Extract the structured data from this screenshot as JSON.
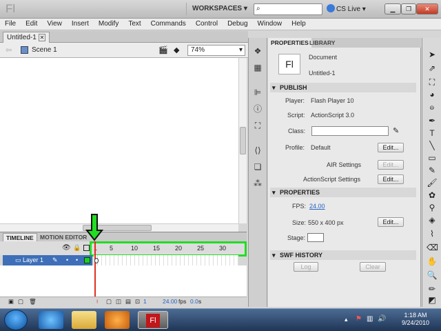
{
  "app": {
    "logo": "Fl",
    "workspaces": "WORKSPACES",
    "cs_live": "CS Live"
  },
  "menu": [
    "File",
    "Edit",
    "View",
    "Insert",
    "Modify",
    "Text",
    "Commands",
    "Control",
    "Debug",
    "Window",
    "Help"
  ],
  "document": {
    "tab": "Untitled-1",
    "scene": "Scene 1",
    "zoom": "74%"
  },
  "timeline": {
    "tabs": [
      "TIMELINE",
      "MOTION EDITOR"
    ],
    "frame_numbers": [
      "1",
      "5",
      "10",
      "15",
      "20",
      "25",
      "30"
    ],
    "layer": "Layer 1",
    "status_frame": "1",
    "status_fps": "24.00",
    "status_fps_unit": "fps",
    "status_time": "0.0",
    "status_time_unit": "s"
  },
  "properties": {
    "tabs": [
      "PROPERTIES",
      "LIBRARY"
    ],
    "doc_icon": "Fl",
    "doc_type": "Document",
    "doc_name": "Untitled-1",
    "publish_header": "PUBLISH",
    "player_label": "Player:",
    "player_value": "Flash Player 10",
    "script_label": "Script:",
    "script_value": "ActionScript 3.0",
    "class_label": "Class:",
    "profile_label": "Profile:",
    "profile_value": "Default",
    "edit_label": "Edit...",
    "air_settings": "AIR Settings",
    "as_settings": "ActionScript Settings",
    "properties_header": "PROPERTIES",
    "fps_label": "FPS:",
    "fps_value": "24.00",
    "size_label": "Size:",
    "size_value": "550 x 400 px",
    "stage_label": "Stage:",
    "swf_header": "SWF HISTORY",
    "log_label": "Log",
    "clear_label": "Clear"
  },
  "taskbar": {
    "time": "1:18 AM",
    "date": "9/24/2010",
    "flash_icon": "Fl"
  },
  "colors": {
    "highlight": "#22dd22",
    "layer_selected": "#3e6fb8",
    "playhead": "#e03020"
  }
}
